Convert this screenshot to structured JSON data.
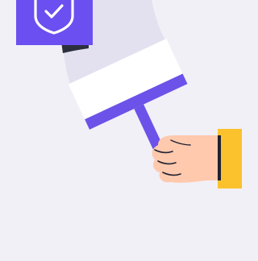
{
  "illustration": {
    "subject": "hand-holding-squeegee-wiping",
    "icons": [
      "shield-check-icon"
    ],
    "colors": {
      "background": "#f1f0f7",
      "accent_purple": "#6c52e8",
      "badge_purple": "#6b4ff0",
      "wiped_trail": "#e3e1ef",
      "blade_white": "#ffffff",
      "skin": "#ffc9ad",
      "sleeve_yellow": "#fbc22e",
      "outline": "#1f2233",
      "dark_shadow": "#2b2f3d"
    }
  }
}
